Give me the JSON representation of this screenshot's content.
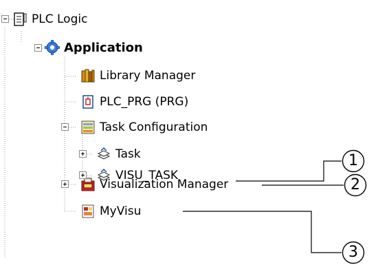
{
  "tree": {
    "items": [
      {
        "label": "PLC Logic",
        "icon": "plc-logic-icon",
        "expander": "minus"
      },
      {
        "label": "Application",
        "icon": "application-gear-icon",
        "expander": "minus"
      },
      {
        "label": "Library Manager",
        "icon": "library-manager-books-icon",
        "expander": "none"
      },
      {
        "label": "PLC_PRG (PRG)",
        "icon": "program-pou-icon",
        "expander": "none"
      },
      {
        "label": "Task Configuration",
        "icon": "task-configuration-icon",
        "expander": "minus"
      },
      {
        "label": "Task",
        "icon": "task-icon",
        "expander": "plus"
      },
      {
        "label": "VISU_TASK",
        "icon": "visu-task-icon",
        "expander": "plus"
      },
      {
        "label": "Visualization Manager",
        "icon": "visualization-manager-icon",
        "expander": "plus"
      },
      {
        "label": "MyVisu",
        "icon": "visualization-icon",
        "expander": "none"
      }
    ]
  },
  "callouts": [
    {
      "number": "1",
      "target": "VISU_TASK"
    },
    {
      "number": "2",
      "target": "Visualization Manager"
    },
    {
      "number": "3",
      "target": "MyVisu"
    }
  ],
  "colors": {
    "tree_lines": "#9a9a9a",
    "callout_line": "#000000",
    "gear": "#3a7bd5",
    "library": "#d08a1c",
    "visu_red": "#c62828"
  }
}
